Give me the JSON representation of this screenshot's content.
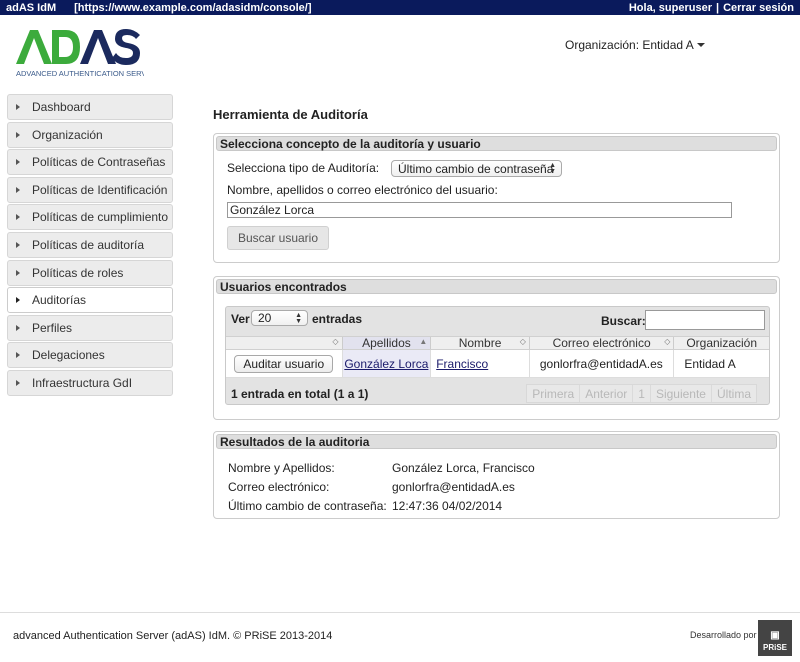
{
  "topbar": {
    "app_name": "adAS IdM",
    "url": "[https://www.example.com/adasidm/console/]",
    "greeting": "Hola, superuser",
    "separator": "|",
    "logout": "Cerrar sesión"
  },
  "header": {
    "logo_text": "ADAS",
    "logo_subtitle": "ADVANCED AUTHENTICATION SERVER",
    "organization_label": "Organización: Entidad A"
  },
  "sidebar": {
    "items": [
      {
        "label": "Dashboard"
      },
      {
        "label": "Organización"
      },
      {
        "label": "Políticas de Contraseñas"
      },
      {
        "label": "Políticas de Identificación"
      },
      {
        "label": "Políticas de cumplimiento"
      },
      {
        "label": "Políticas de auditoría"
      },
      {
        "label": "Políticas de roles"
      },
      {
        "label": "Auditorías",
        "active": true
      },
      {
        "label": "Perfiles"
      },
      {
        "label": "Delegaciones"
      },
      {
        "label": "Infraestructura GdI"
      }
    ]
  },
  "main": {
    "title": "Herramienta de Auditoría",
    "concept_panel": {
      "title": "Selecciona concepto de la auditoría y usuario",
      "type_label": "Selecciona tipo de Auditoría:",
      "type_value": "Último cambio de contraseña",
      "user_label": "Nombre, apellidos o correo electrónico del usuario:",
      "user_value": "González Lorca",
      "search_button": "Buscar usuario"
    },
    "users_panel": {
      "title": "Usuarios encontrados",
      "show_label": "Ver",
      "page_size": "20",
      "entries_label": "entradas",
      "search_label": "Buscar:",
      "search_value": "",
      "columns": [
        "",
        "Apellidos",
        "Nombre",
        "Correo electrónico",
        "Organización"
      ],
      "rows": [
        {
          "action": "Auditar usuario",
          "apellidos": "González Lorca",
          "nombre": "Francisco",
          "correo": "gonlorfra@entidadA.es",
          "organizacion": "Entidad A"
        }
      ],
      "info": "1 entrada en total (1 a 1)",
      "pager": [
        "Primera",
        "Anterior",
        "1",
        "Siguiente",
        "Última"
      ]
    },
    "results_panel": {
      "title": "Resultados de la auditoria",
      "fields": [
        {
          "label": "Nombre y Apellidos:",
          "value": "González Lorca, Francisco"
        },
        {
          "label": "Correo electrónico:",
          "value": "gonlorfra@entidadA.es"
        },
        {
          "label": "Último cambio de contraseña:",
          "value": "12:47:36 04/02/2014"
        }
      ]
    }
  },
  "footer": {
    "credit": "advanced Authentication Server (adAS) IdM. © PRiSE 2013-2014",
    "developed_by": "Desarrollado por",
    "prise_badge": "PRiSE"
  },
  "colors": {
    "topbar_bg": "#0a1a5c",
    "logo_green": "#3cab3c",
    "logo_navy": "#1b2a5e"
  }
}
